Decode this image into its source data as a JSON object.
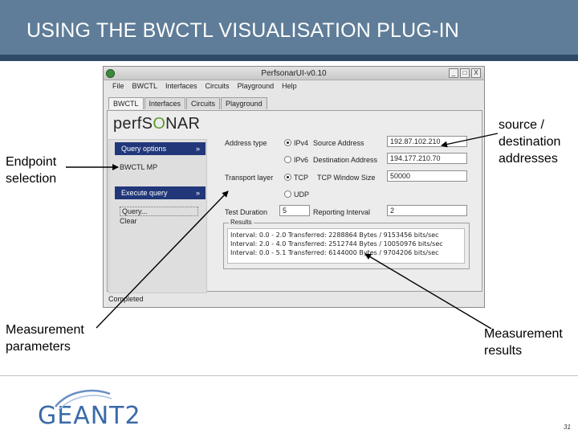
{
  "slide": {
    "title": "USING THE BWCTL VISUALISATION PLUG-IN",
    "page_number": "31",
    "logo_text": "GEANT2"
  },
  "annotations": {
    "endpoint": [
      "Endpoint",
      "selection"
    ],
    "source": [
      "source /",
      "destination",
      "addresses"
    ],
    "params": [
      "Measurement",
      "parameters"
    ],
    "results": [
      "Measurement",
      "results"
    ]
  },
  "window": {
    "title": "PerfsonarUI-v0.10",
    "buttons": [
      "_",
      "□",
      "X"
    ],
    "menu": [
      "File",
      "BWCTL",
      "Interfaces",
      "Circuits",
      "Playground",
      "Help"
    ],
    "tabs": [
      "BWCTL",
      "Interfaces",
      "Circuits",
      "Playground"
    ],
    "logo": {
      "left": "perfS",
      "mark": "O",
      "right": "NAR"
    },
    "sidebar": {
      "query_options": "Query options",
      "query_item": "BWCTL MP",
      "execute_query": "Execute query",
      "query_label": "Query...",
      "clear_label": "Clear",
      "chevron": "»"
    },
    "form": {
      "address_type": "Address type",
      "ipv4": "IPv4",
      "ipv6": "IPv6",
      "source_address": "Source Address",
      "source_value": "192.87.102.210",
      "destination_address": "Destination Address",
      "destination_value": "194.177.210.70",
      "transport_layer": "Transport layer",
      "tcp": "TCP",
      "udp": "UDP",
      "tcp_window": "TCP Window Size",
      "tcp_window_value": "50000",
      "test_duration": "Test Duration",
      "test_duration_value": "5",
      "reporting_interval": "Reporting Interval",
      "reporting_interval_value": "2"
    },
    "results": {
      "title": "Results",
      "lines": [
        "Interval: 0.0 - 2.0 Transferred: 2288864 Bytes / 9153456 bits/sec",
        "Interval: 2.0 - 4.0 Transferred: 2512744 Bytes / 10050976 bits/sec",
        "Interval: 0.0 - 5.1 Transferred: 6144000 Bytes / 9704206 bits/sec"
      ]
    },
    "status": "Completed"
  }
}
